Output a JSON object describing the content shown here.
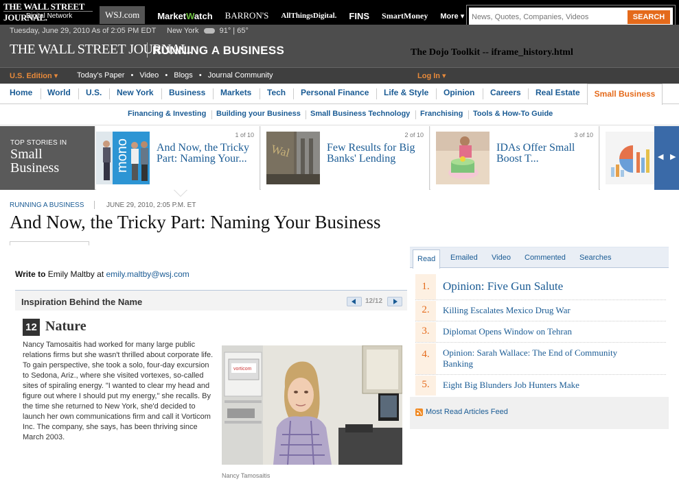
{
  "network": {
    "logo_title": "THE WALL STREET JOURNAL.",
    "logo_sub": "Digital Network",
    "links": [
      "WSJ.com",
      "Market",
      "atch",
      "BARRON'S",
      "AllThingsDigital.",
      "FINS",
      "SmartMoney",
      "More ▾"
    ],
    "mw_w": "W"
  },
  "search": {
    "placeholder": "News, Quotes, Companies, Videos",
    "button": "SEARCH"
  },
  "header": {
    "date": "Tuesday, June 29, 2010 As of 2:05 PM EDT",
    "city": "New York",
    "temp": "91° | 65°",
    "masthead": "THE WALL STREET JOURNAL.",
    "section": "RUNNING A BUSINESS",
    "window_title": "The Dojo Toolkit -- iframe_history.html"
  },
  "subbar": {
    "edition": "U.S. Edition ▾",
    "links": [
      "Today's Paper",
      "•",
      "Video",
      "•",
      "Blogs",
      "•",
      "Journal Community"
    ],
    "login": "Log In ▾"
  },
  "mainnav": [
    "Home",
    "World",
    "U.S.",
    "New York",
    "Business",
    "Markets",
    "Tech",
    "Personal Finance",
    "Life & Style",
    "Opinion",
    "Careers",
    "Real Estate"
  ],
  "mainnav_active": "Small Business",
  "secnav": [
    "Financing & Investing",
    "Building your Business",
    "Small Business Technology",
    "Franchising",
    "Tools & How-To Guide"
  ],
  "topstories": {
    "label_small": "TOP STORIES IN",
    "label_big_1": "Small",
    "label_big_2": "Business",
    "stories": [
      {
        "count": "1 of 10",
        "headline": "And Now, the Tricky Part: Naming Your..."
      },
      {
        "count": "2 of 10",
        "headline": "Few Results for Big Banks' Lending"
      },
      {
        "count": "3 of 10",
        "headline": "IDAs Offer Small Boost T..."
      }
    ],
    "thumb1_text": "mono",
    "thumb2_text": "Wal"
  },
  "article": {
    "kicker": "RUNNING A BUSINESS",
    "date": "JUNE 29, 2010, 2:05 P.M. ET",
    "title": "And Now, the Tricky Part: Naming Your Business",
    "write_to_label": "Write to",
    "author": "Emily Maltby at",
    "email": "emily.maltby@wsj.com"
  },
  "slideshow": {
    "title": "Inspiration Behind the Name",
    "pages": "12/12",
    "number": "12",
    "name": "Nature",
    "body": "Nancy Tamosaitis had worked for many large public relations firms but she wasn't thrilled about corporate life. To gain perspective, she took a solo, four-day excursion to Sedona, Ariz., where she visited vortexes, so-called sites of spiraling energy. \"I wanted to clear my head and figure out where I should put my energy,\" she recalls. By the time she returned to New York, she'd decided to launch her own communications firm and call it Vorticom Inc. The company, she says, has been thriving since March 2003.",
    "photo_sign": "vorticom",
    "caption": "Nancy Tamosaitis"
  },
  "mostread": {
    "tabs": [
      "Read",
      "Emailed",
      "Video",
      "Commented",
      "Searches"
    ],
    "items": [
      {
        "num": "1.",
        "title": "Opinion: Five Gun Salute"
      },
      {
        "num": "2.",
        "title": "Killing Escalates Mexico Drug War"
      },
      {
        "num": "3.",
        "title": "Diplomat Opens Window on Tehran"
      },
      {
        "num": "4.",
        "title": "Opinion: Sarah Wallace: The End of Community Banking"
      },
      {
        "num": "5.",
        "title": "Eight Big Blunders Job Hunters Make"
      }
    ],
    "feed": "Most Read Articles Feed"
  }
}
